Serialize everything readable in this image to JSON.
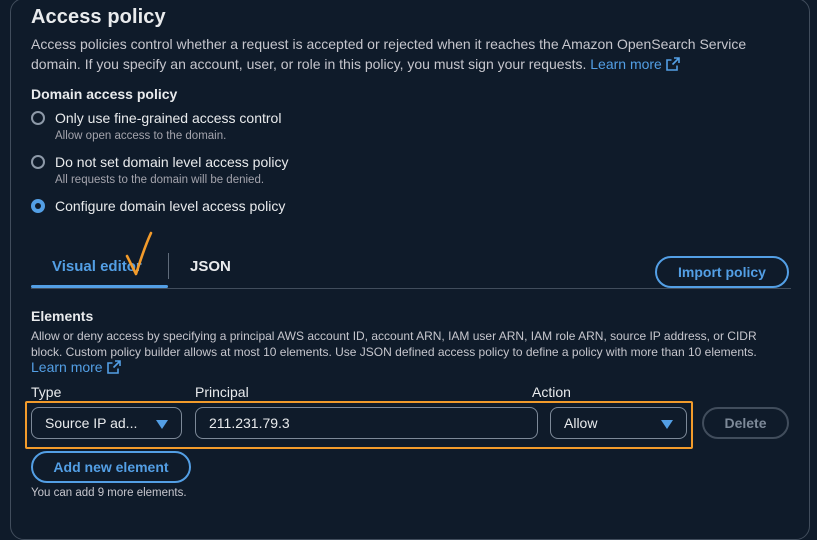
{
  "section": {
    "title": "Access policy",
    "description": "Access policies control whether a request is accepted or rejected when it reaches the Amazon OpenSearch Service domain. If you specify an account, user, or role in this policy, you must sign your requests.",
    "learn_more": "Learn more"
  },
  "domain_access_policy": {
    "label": "Domain access policy",
    "options": [
      {
        "label": "Only use fine-grained access control",
        "hint": "Allow open access to the domain.",
        "selected": false
      },
      {
        "label": "Do not set domain level access policy",
        "hint": "All requests to the domain will be denied.",
        "selected": false
      },
      {
        "label": "Configure domain level access policy",
        "hint": "",
        "selected": true
      }
    ]
  },
  "tabs": [
    {
      "label": "Visual editor",
      "active": true
    },
    {
      "label": "JSON",
      "active": false
    }
  ],
  "import_policy_label": "Import policy",
  "elements": {
    "label": "Elements",
    "description": "Allow or deny access by specifying a principal AWS account ID, account ARN, IAM user ARN, IAM role ARN, source IP address, or CIDR block. Custom policy builder allows at most 10 elements. Use JSON defined access policy to define a policy with more than 10 elements.",
    "learn_more": "Learn more",
    "columns": {
      "type": "Type",
      "principal": "Principal",
      "action": "Action"
    },
    "row": {
      "type": "Source IP ad...",
      "principal": "211.231.79.3",
      "action": "Allow"
    },
    "delete_label": "Delete",
    "add_label": "Add new element",
    "remaining_text": "You can add 9 more elements."
  },
  "colors": {
    "accent": "#539fe5",
    "annotation": "#f29b2b",
    "background": "#0f1b2a"
  },
  "annotations": {
    "checkmark_color": "#f29b2b"
  }
}
